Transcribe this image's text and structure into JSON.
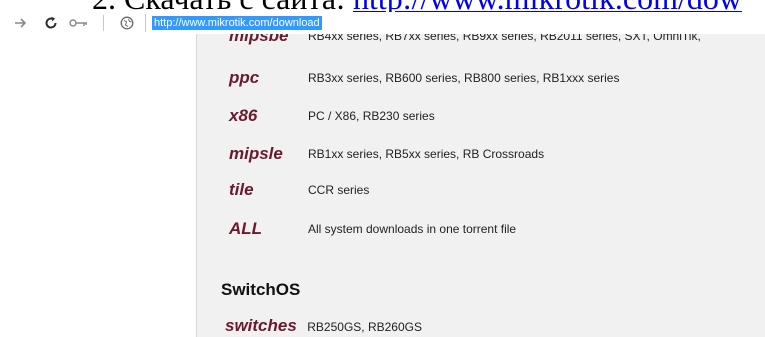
{
  "document": {
    "heading_prefix": "2.   Скачать с сайта: ",
    "heading_link": "http://www.mikrotik.com/dow"
  },
  "browser": {
    "address_url": "http://www.mikrotik.com/download"
  },
  "page": {
    "archs": [
      {
        "name": "mipsbe",
        "desc": "RB4xx series, RB7xx series, RB9xx series, RB2011 series, SXT, OmniTik,"
      },
      {
        "name": "ppc",
        "desc": "RB3xx series, RB600 series, RB800 series, RB1xxx series"
      },
      {
        "name": "x86",
        "desc": "PC / X86, RB230 series"
      },
      {
        "name": "mipsle",
        "desc": "RB1xx series, RB5xx series, RB Crossroads"
      },
      {
        "name": "tile",
        "desc": "CCR series"
      },
      {
        "name": "ALL",
        "desc": "All system downloads in one torrent file"
      }
    ],
    "switchos_title": "SwitchOS",
    "switches": {
      "name": "switches",
      "desc": "RB250GS, RB260GS"
    }
  },
  "colors": {
    "arch_name": "#6b1a2e",
    "panel_bg": "#f1f1f1",
    "url_selection": "#3399ff",
    "link": "#0000ee"
  },
  "icons": [
    "forward-arrow-icon",
    "reload-icon",
    "key-icon",
    "globe-icon"
  ]
}
